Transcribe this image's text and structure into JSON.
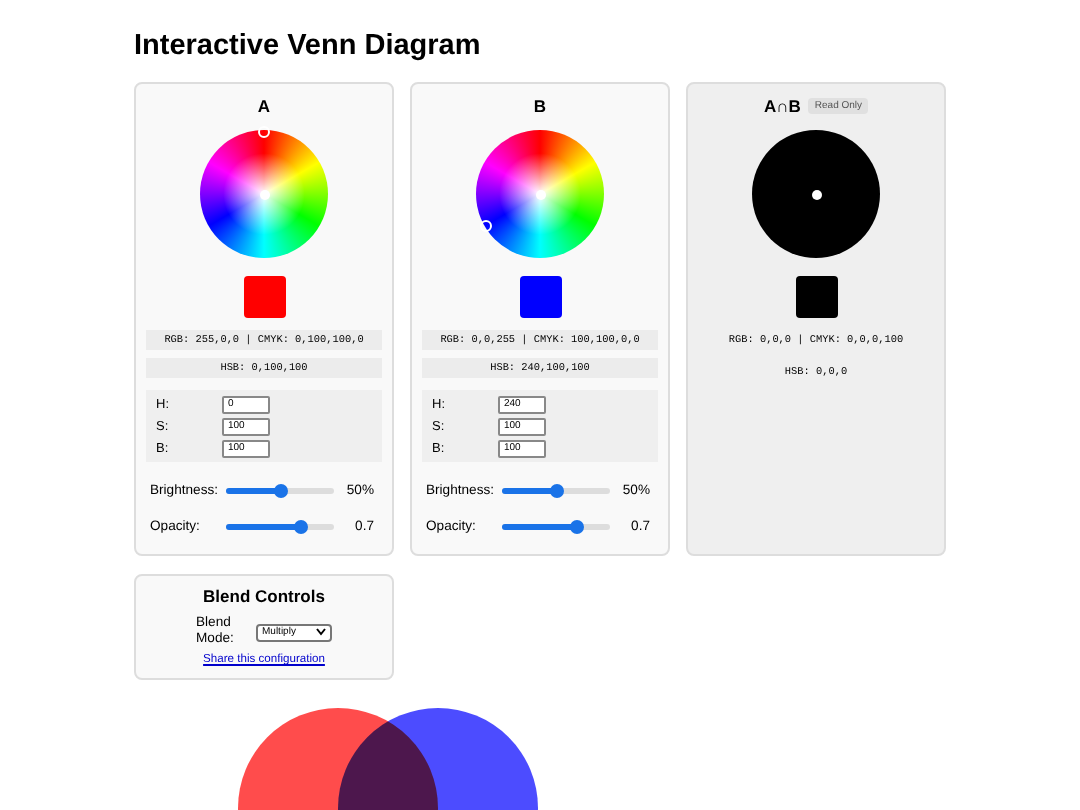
{
  "title": "Interactive Venn Diagram",
  "panels": [
    {
      "kind": "editable",
      "label": "A",
      "color": "#ff0000",
      "rgb_cmyk": "RGB: 255,0,0 | CMYK: 0,100,100,0",
      "hsb": "HSB: 0,100,100",
      "inputs": [
        {
          "label": "H:",
          "value": "0"
        },
        {
          "label": "S:",
          "value": "100"
        },
        {
          "label": "B:",
          "value": "100"
        }
      ],
      "sliders": [
        {
          "label": "Brightness:",
          "level": 0.5,
          "reading": "50%"
        },
        {
          "label": "Opacity:",
          "level": 0.7,
          "reading": "0.7"
        }
      ]
    },
    {
      "kind": "editable",
      "label": "B",
      "color": "#0000ff",
      "rgb_cmyk": "RGB: 0,0,255 | CMYK: 100,100,0,0",
      "hsb": "HSB: 240,100,100",
      "inputs": [
        {
          "label": "H:",
          "value": "240"
        },
        {
          "label": "S:",
          "value": "100"
        },
        {
          "label": "B:",
          "value": "100"
        }
      ],
      "sliders": [
        {
          "label": "Brightness:",
          "level": 0.5,
          "reading": "50%"
        },
        {
          "label": "Opacity:",
          "level": 0.7,
          "reading": "0.7"
        }
      ]
    },
    {
      "kind": "result",
      "label": "A∩B",
      "badge": "Read Only",
      "color": "#000000",
      "rgb_cmyk": "RGB: 0,0,0 | CMYK: 0,0,0,100",
      "hsb": "HSB: 0,0,0"
    }
  ],
  "blend": {
    "title": "Blend Controls",
    "mode_label": "Blend Mode:",
    "mode_value": "Multiply",
    "link": "Share this configuration"
  }
}
